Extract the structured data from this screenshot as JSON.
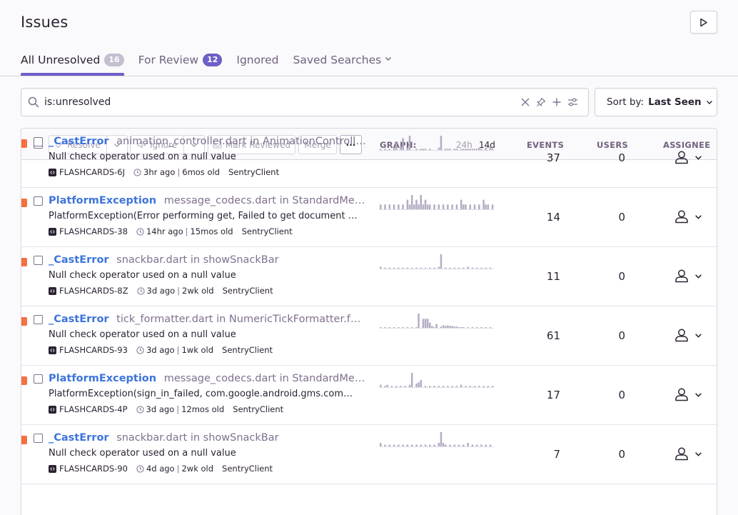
{
  "page": {
    "title": "Issues"
  },
  "tabs": [
    {
      "label": "All Unresolved",
      "badge": "16"
    },
    {
      "label": "For Review",
      "badge": "12"
    },
    {
      "label": "Ignored"
    },
    {
      "label": "Saved Searches"
    }
  ],
  "search": {
    "query": "is:unresolved"
  },
  "sort": {
    "label": "Sort by:",
    "value": "Last Seen"
  },
  "header": {
    "resolve": "Resolve",
    "ignore": "Ignore",
    "mark_reviewed": "Mark Reviewed",
    "merge": "Merge",
    "more": "···",
    "graph": "GRAPH:",
    "period_24h": "24h",
    "period_14d": "14d",
    "events": "EVENTS",
    "users": "USERS",
    "assignee": "ASSIGNEE"
  },
  "colors": {
    "accent": "#6c5fc7",
    "link": "#3d74db",
    "level_error": "#f5703f",
    "spark": "#b5adc3"
  },
  "issues": [
    {
      "type": "_CastError",
      "location": "animation_controller.dart in AnimationController.st…",
      "message": "Null check operator used on a null value",
      "short_id": "FLASHCARDS-6J",
      "last_seen": "3hr ago",
      "first_seen": "6mos old",
      "client": "SentryClient",
      "events": "37",
      "users": "0",
      "spark": [
        1,
        0,
        1,
        0,
        1,
        0,
        2,
        6,
        0,
        3,
        10,
        0,
        2,
        12,
        0,
        0,
        1,
        0,
        1,
        1,
        1,
        0,
        1,
        0,
        0,
        0,
        2,
        12,
        0,
        1,
        1,
        1,
        0,
        1,
        1,
        0,
        1,
        1,
        1,
        1,
        1,
        1,
        1,
        1,
        2,
        1,
        0,
        2,
        0,
        3,
        1
      ]
    },
    {
      "type": "PlatformException",
      "location": "message_codecs.dart in StandardMethod…",
      "message": "PlatformException(Error performing get, Failed to get document b…",
      "short_id": "FLASHCARDS-38",
      "last_seen": "14hr ago",
      "first_seen": "15mos old",
      "client": "SentryClient",
      "events": "14",
      "users": "0",
      "spark": [
        1,
        0,
        1,
        0,
        1,
        0,
        1,
        0,
        1,
        0,
        1,
        0,
        2,
        1,
        3,
        1,
        2,
        1,
        3,
        1,
        2,
        1,
        1,
        0,
        1,
        0,
        1,
        0,
        1,
        0,
        1,
        0,
        1,
        0,
        1,
        0,
        2,
        1,
        1,
        0,
        1,
        0,
        1,
        0,
        1,
        0,
        2,
        1,
        1,
        0,
        1
      ]
    },
    {
      "type": "_CastError",
      "location": "snackbar.dart in showSnackBar",
      "message": "Null check operator used on a null value",
      "short_id": "FLASHCARDS-8Z",
      "last_seen": "3d ago",
      "first_seen": "2wk old",
      "client": "SentryClient",
      "events": "11",
      "users": "0",
      "spark": [
        2,
        0,
        1,
        0,
        1,
        0,
        1,
        0,
        1,
        0,
        1,
        0,
        1,
        0,
        1,
        0,
        1,
        0,
        1,
        0,
        1,
        0,
        1,
        0,
        1,
        0,
        2,
        16,
        0,
        1,
        0,
        1,
        0,
        1,
        0,
        1,
        0,
        1,
        0,
        2,
        0,
        1,
        0,
        1,
        0,
        1,
        0,
        1,
        0,
        1,
        0
      ]
    },
    {
      "type": "_CastError",
      "location": "tick_formatter.dart in NumericTickFormatter.format…",
      "message": "Null check operator used on a null value",
      "short_id": "FLASHCARDS-93",
      "last_seen": "3d ago",
      "first_seen": "1wk old",
      "client": "SentryClient",
      "events": "61",
      "users": "0",
      "spark": [
        1,
        0,
        1,
        0,
        1,
        0,
        1,
        0,
        1,
        0,
        1,
        0,
        1,
        0,
        1,
        0,
        1,
        22,
        0,
        14,
        14,
        14,
        8,
        3,
        1,
        6,
        0,
        2,
        4,
        3,
        4,
        3,
        3,
        2,
        2,
        1,
        1,
        1,
        0,
        1,
        0,
        1,
        0,
        1,
        0,
        1,
        0,
        1,
        0,
        1,
        0
      ]
    },
    {
      "type": "PlatformException",
      "location": "message_codecs.dart in StandardMethod…",
      "message": "PlatformException(sign_in_failed, com.google.android.gms.com…",
      "short_id": "FLASHCARDS-4P",
      "last_seen": "3d ago",
      "first_seen": "12mos old",
      "client": "SentryClient",
      "events": "17",
      "users": "0",
      "spark": [
        2,
        0,
        1,
        2,
        0,
        1,
        0,
        1,
        0,
        1,
        0,
        1,
        0,
        2,
        12,
        0,
        3,
        4,
        6,
        0,
        1,
        0,
        1,
        0,
        1,
        0,
        1,
        0,
        1,
        0,
        1,
        0,
        1,
        0,
        1,
        0,
        2,
        0,
        1,
        0,
        1,
        0,
        1,
        0,
        1,
        0,
        1,
        0,
        1,
        0,
        1
      ]
    },
    {
      "type": "_CastError",
      "location": "snackbar.dart in showSnackBar",
      "message": "Null check operator used on a null value",
      "short_id": "FLASHCARDS-90",
      "last_seen": "4d ago",
      "first_seen": "2wk old",
      "client": "SentryClient",
      "events": "7",
      "users": "0",
      "spark": [
        2,
        0,
        1,
        0,
        1,
        0,
        1,
        0,
        1,
        0,
        1,
        0,
        1,
        0,
        1,
        0,
        1,
        0,
        1,
        0,
        1,
        0,
        1,
        0,
        1,
        0,
        2,
        8,
        2,
        1,
        0,
        1,
        0,
        1,
        0,
        1,
        0,
        1,
        0,
        2,
        0,
        1,
        0,
        1,
        0,
        1,
        0,
        1,
        0,
        1,
        0
      ]
    }
  ]
}
